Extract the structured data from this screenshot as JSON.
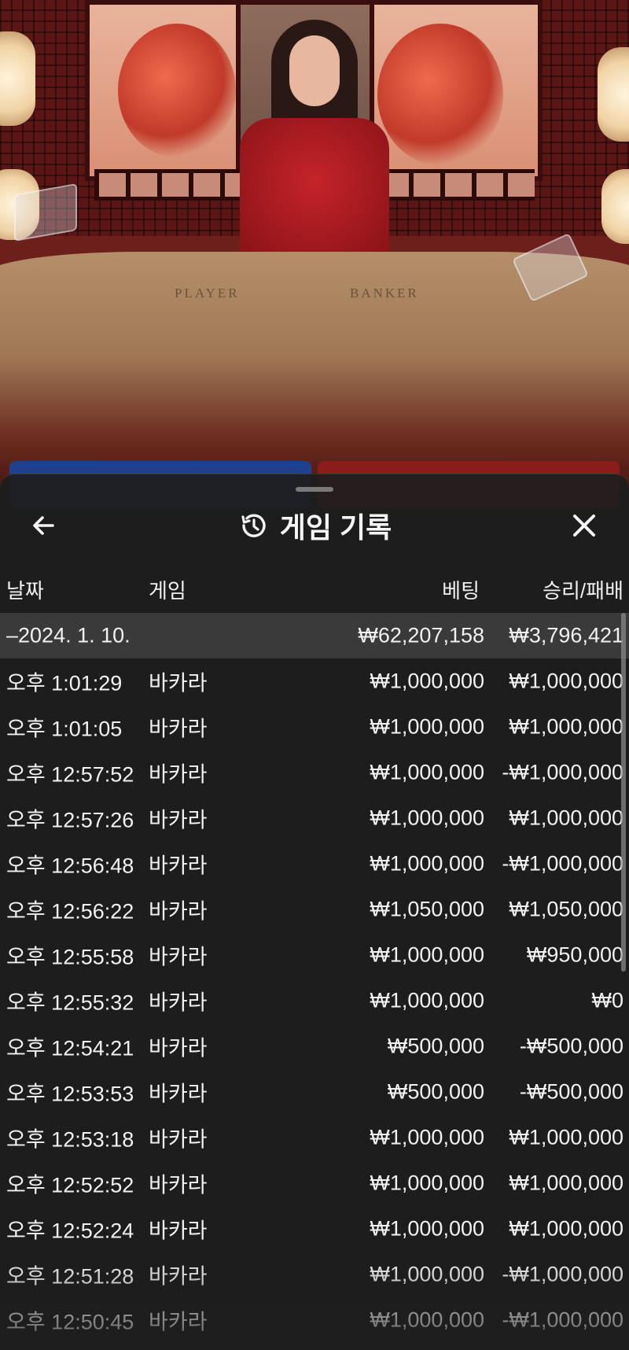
{
  "header": {
    "title": "게임 기록",
    "back_icon": "arrow-left-icon",
    "history_icon": "history-clock-icon",
    "close_icon": "close-icon"
  },
  "table_labels": {
    "player": "PLAYER",
    "banker": "BANKER"
  },
  "columns": {
    "date": "날짜",
    "game": "게임",
    "bet": "베팅",
    "win_loss": "승리/패배"
  },
  "date_group": {
    "date": "–2024. 1. 10.",
    "bet_total": "₩62,207,158",
    "win_loss_total": "₩3,796,421"
  },
  "rows": [
    {
      "time": "오후 1:01:29",
      "game": "바카라",
      "bet": "₩1,000,000",
      "win_loss": "₩1,000,000"
    },
    {
      "time": "오후 1:01:05",
      "game": "바카라",
      "bet": "₩1,000,000",
      "win_loss": "₩1,000,000"
    },
    {
      "time": "오후 12:57:52",
      "game": "바카라",
      "bet": "₩1,000,000",
      "win_loss": "-₩1,000,000"
    },
    {
      "time": "오후 12:57:26",
      "game": "바카라",
      "bet": "₩1,000,000",
      "win_loss": "₩1,000,000"
    },
    {
      "time": "오후 12:56:48",
      "game": "바카라",
      "bet": "₩1,000,000",
      "win_loss": "-₩1,000,000"
    },
    {
      "time": "오후 12:56:22",
      "game": "바카라",
      "bet": "₩1,050,000",
      "win_loss": "₩1,050,000"
    },
    {
      "time": "오후 12:55:58",
      "game": "바카라",
      "bet": "₩1,000,000",
      "win_loss": "₩950,000"
    },
    {
      "time": "오후 12:55:32",
      "game": "바카라",
      "bet": "₩1,000,000",
      "win_loss": "₩0"
    },
    {
      "time": "오후 12:54:21",
      "game": "바카라",
      "bet": "₩500,000",
      "win_loss": "-₩500,000"
    },
    {
      "time": "오후 12:53:53",
      "game": "바카라",
      "bet": "₩500,000",
      "win_loss": "-₩500,000"
    },
    {
      "time": "오후 12:53:18",
      "game": "바카라",
      "bet": "₩1,000,000",
      "win_loss": "₩1,000,000"
    },
    {
      "time": "오후 12:52:52",
      "game": "바카라",
      "bet": "₩1,000,000",
      "win_loss": "₩1,000,000"
    },
    {
      "time": "오후 12:52:24",
      "game": "바카라",
      "bet": "₩1,000,000",
      "win_loss": "₩1,000,000"
    },
    {
      "time": "오후 12:51:28",
      "game": "바카라",
      "bet": "₩1,000,000",
      "win_loss": "-₩1,000,000"
    },
    {
      "time": "오후 12:50:45",
      "game": "바카라",
      "bet": "₩1,000,000",
      "win_loss": "-₩1,000,000"
    }
  ]
}
